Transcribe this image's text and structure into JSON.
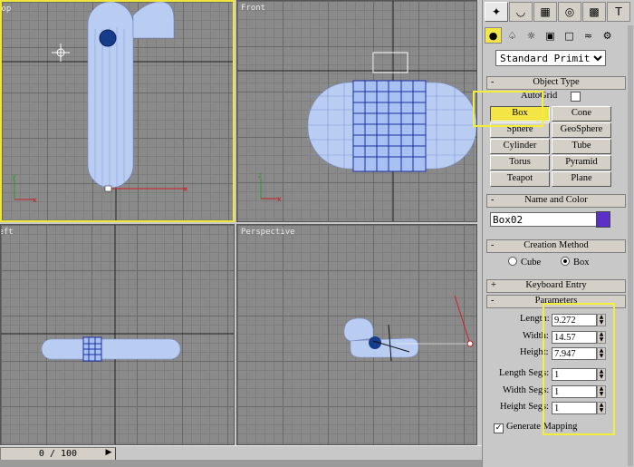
{
  "viewports": {
    "top": {
      "label": "Top"
    },
    "front": {
      "label": "Front"
    },
    "left": {
      "label": "Left"
    },
    "perspective": {
      "label": "Perspective"
    }
  },
  "timeline": {
    "frame": "0 / 100",
    "next_icon": "chevron-right-icon"
  },
  "panel": {
    "tabs": [
      {
        "name": "create",
        "icon": "cursor-star-icon"
      },
      {
        "name": "modify",
        "icon": "modify-arc-icon"
      },
      {
        "name": "hierarchy",
        "icon": "hierarchy-icon"
      },
      {
        "name": "motion",
        "icon": "motion-icon"
      },
      {
        "name": "display",
        "icon": "display-icon"
      },
      {
        "name": "utilities",
        "icon": "hammer-icon"
      }
    ],
    "categories": [
      "geometry-icon",
      "shapes-icon",
      "lights-icon",
      "cameras-icon",
      "helpers-icon",
      "spacewarps-icon",
      "systems-icon"
    ],
    "dropdown": {
      "value": "Standard Primitiv"
    },
    "object_type": {
      "title": "Object Type",
      "autogrid": "AutoGrid",
      "buttons": [
        "Box",
        "Cone",
        "Sphere",
        "GeoSphere",
        "Cylinder",
        "Tube",
        "Torus",
        "Pyramid",
        "Teapot",
        "Plane"
      ],
      "selected": "Box"
    },
    "name_color": {
      "title": "Name and Color",
      "name": "Box02",
      "color": "#5c2fc8"
    },
    "creation_method": {
      "title": "Creation Method",
      "cube": "Cube",
      "box": "Box",
      "selected": "Box"
    },
    "keyboard_entry": {
      "title": "Keyboard Entry"
    },
    "parameters": {
      "title": "Parameters",
      "length_label": "Length:",
      "length": "9.272",
      "width_label": "Width:",
      "width": "14.57",
      "height_label": "Height:",
      "height": "7.947",
      "length_segs_label": "Length Segs:",
      "length_segs": "1",
      "width_segs_label": "Width Segs:",
      "width_segs": "1",
      "height_segs_label": "Height Segs:",
      "height_segs": "1",
      "generate_mapping": "Generate Mapping",
      "generate_mapping_checked": true
    }
  },
  "colors": {
    "viewport_bg": "#8a8a8a",
    "active_border": "#f0e63a",
    "wire_light": "#b9cdf3",
    "wire_dark": "#1a2fa0",
    "highlight": "#f3e545"
  }
}
